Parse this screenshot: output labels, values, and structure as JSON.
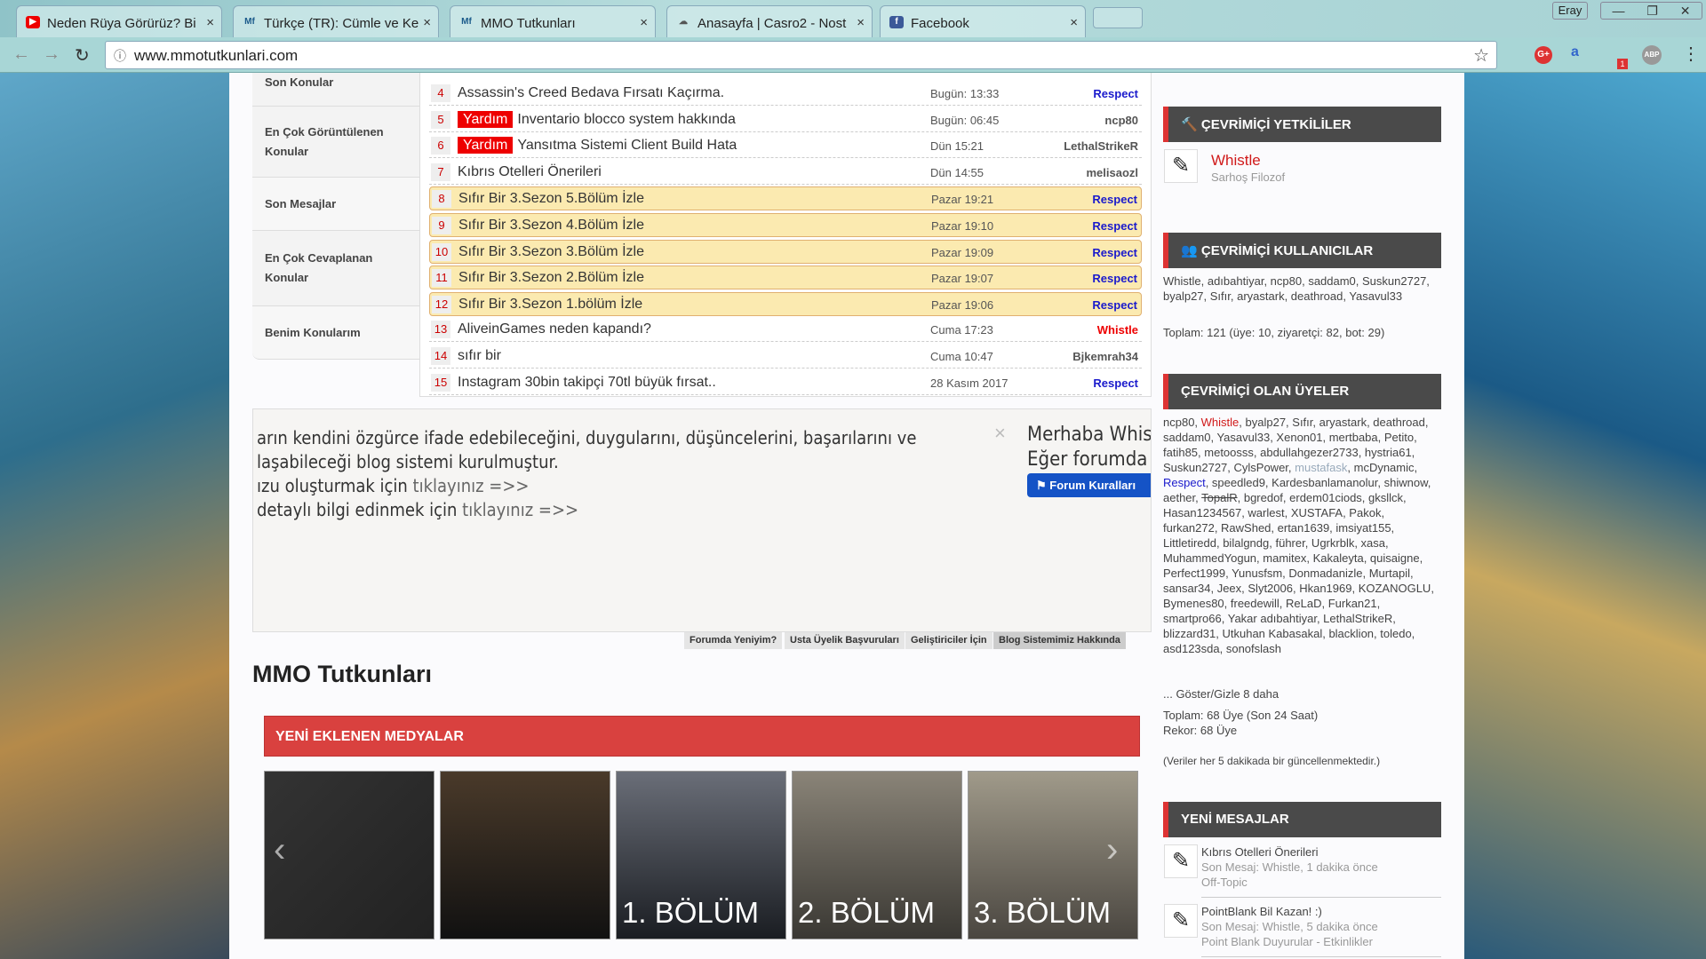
{
  "browser": {
    "tabs": [
      {
        "title": "Neden Rüya Görürüz? Bi",
        "icon": "youtube-icon"
      },
      {
        "title": "Türkçe (TR): Cümle ve Ke",
        "icon": "mmo-icon"
      },
      {
        "title": "MMO Tutkunları",
        "icon": "mmo-icon",
        "active": true
      },
      {
        "title": "Anasayfa | Casro2 - Nost",
        "icon": "casro-icon"
      },
      {
        "title": "Facebook",
        "icon": "facebook-icon"
      }
    ],
    "url": "www.mmotutkunlari.com",
    "profile": "Eray",
    "ext_badge": "1",
    "ext_abp": "ABP",
    "ext_gplus": "G+"
  },
  "nav": [
    "Son Konular",
    "En Çok Görüntülenen Konular",
    "Son Mesajlar",
    "En Çok Cevaplanan Konular",
    "Benim Konularım"
  ],
  "topics": [
    {
      "n": "4",
      "title": "Assassin's Creed Bedava Fırsatı Kaçırma.",
      "date": "Bugün: 13:33",
      "user": "Respect",
      "color": "#1a1acc"
    },
    {
      "n": "5",
      "badge": "Yardım",
      "title": "Inventario blocco system hakkında",
      "date": "Bugün: 06:45",
      "user": "ncp80",
      "color": "#555"
    },
    {
      "n": "6",
      "badge": "Yardım",
      "title": "Yansıtma Sistemi Client Build Hata",
      "date": "Dün 15:21",
      "user": "LethalStrikeR",
      "color": "#555"
    },
    {
      "n": "7",
      "title": "Kıbrıs Otelleri Önerileri",
      "date": "Dün 14:55",
      "user": "melisaozl",
      "color": "#555"
    },
    {
      "n": "8",
      "title": "Sıfır Bir 3.Sezon 5.Bölüm İzle",
      "date": "Pazar 19:21",
      "user": "Respect",
      "color": "#1a1acc",
      "hl": true
    },
    {
      "n": "9",
      "title": "Sıfır Bir 3.Sezon 4.Bölüm İzle",
      "date": "Pazar 19:10",
      "user": "Respect",
      "color": "#1a1acc",
      "hl": true
    },
    {
      "n": "10",
      "title": "Sıfır Bir 3.Sezon 3.Bölüm İzle",
      "date": "Pazar 19:09",
      "user": "Respect",
      "color": "#1a1acc",
      "hl": true
    },
    {
      "n": "11",
      "title": "Sıfır Bir 3.Sezon 2.Bölüm İzle",
      "date": "Pazar 19:07",
      "user": "Respect",
      "color": "#1a1acc",
      "hl": true
    },
    {
      "n": "12",
      "title": "Sıfır Bir 3.Sezon 1.bölüm İzle",
      "date": "Pazar 19:06",
      "user": "Respect",
      "color": "#1a1acc",
      "hl": true
    },
    {
      "n": "13",
      "title": "AliveinGames neden kapandı?",
      "date": "Cuma 17:23",
      "user": "Whistle",
      "color": "#e00"
    },
    {
      "n": "14",
      "title": "sıfır bir",
      "date": "Cuma 10:47",
      "user": "Bjkemrah34",
      "color": "#555"
    },
    {
      "n": "15",
      "title": "Instagram 30bin takipçi 70tl büyük fırsat..",
      "date": "28 Kasım 2017",
      "user": "Respect",
      "color": "#1a1acc"
    }
  ],
  "blog": {
    "line1": "arın kendini özgürce ifade edebileceğini, duygularını, düşüncelerini, başarılarını ve",
    "line2": "laşabileceği blog sistemi kurulmuştur.",
    "line3a": "ızu oluşturmak için ",
    "line3b": "tıklayınız =>>",
    "line4a": " detaylı bilgi edinmek için ",
    "line4b": "tıklayınız =>>",
    "right1": "Merhaba Whis",
    "right2": "Eğer forumda",
    "button": "Forum Kuralları"
  },
  "blog_tabs": [
    "Forumda Yeniyim?",
    "Usta Üyelik Başvuruları",
    "Geliştiriciler İçin",
    "Blog Sistemimiz Hakkında"
  ],
  "heading": "MMO Tutkunları",
  "media": {
    "title": "YENİ EKLENEN MEDYALAR",
    "items": [
      "",
      "",
      "1. BÖLÜM",
      "2. BÖLÜM",
      "3. BÖLÜM"
    ]
  },
  "sidebar": {
    "staff": {
      "title": "ÇEVRİMİÇİ YETKİLİLER",
      "name": "Whistle",
      "rank": "Sarhoş Filozof"
    },
    "online": {
      "title": "ÇEVRİMİÇİ KULLANICILAR",
      "users": "Whistle, adıbahtiyar, ncp80, saddam0, Suskun2727, byalp27, Sıfır, aryastark, deathroad, Yasavul33",
      "total": "Toplam: 121 (üye: 10, ziyaretçi: 82, bot: 29)"
    },
    "members": {
      "title": "ÇEVRİMİÇİ OLAN ÜYELER",
      "pre": "ncp80, ",
      "red": "Whistle",
      "mid": ", byalp27, Sıfır, aryastark, deathroad, saddam0, Yasavul33, Xenon01, mertbaba, Petito, fatih85, metoosss, abdullahgezer2733, hystria61, Suskun2727, CylsPower, ",
      "faded": "mustafask",
      "mid2": ", mcDynamic, ",
      "blue": "Respect",
      "mid3": ", speedled9, Kardesbanlamanolur, shiwnow, aether, ",
      "strike": "TopalR",
      "rest": ", bgredof, erdem01ciods, gksllck, Hasan1234567, warlest, XUSTAFA, Pakok, furkan272, RawShed, ertan1639, imsiyat155, Littletiredd, bilalgndg, führer, Ugrkrblk, xasa, MuhammedYogun, mamitex, Kakaleyta, quisaigne, Perfect1999, Yunusfsm, Donmadanizle, Murtapil, sansar34, Jeex, Slyt2006, Hkan1969, KOZANOGLU, Bymenes80, freedewill, ReLaD, Furkan21, smartpro66, Yakar adıbahtiyar, LethalStrikeR, blizzard31, Utkuhan Kabasakal, blacklion, toledo, asd123sda, sonofslash",
      "more": "... Göster/Gizle 8 daha",
      "total": "Toplam: 68 Üye (Son 24 Saat)",
      "record": "Rekor: 68 Üye",
      "note": "(Veriler her 5 dakikada bir güncellenmektedir.)"
    },
    "new_posts": {
      "title": "YENİ MESAJLAR",
      "items": [
        {
          "title": "Kıbrıs Otelleri Önerileri",
          "meta": "Son Mesaj: Whistle, 1 dakika önce",
          "forum": "Off-Topic"
        },
        {
          "title": "PointBlank Bil Kazan! :)",
          "meta": "Son Mesaj: Whistle, 5 dakika önce",
          "forum": "Point Blank Duyurular - Etkinlikler"
        }
      ]
    }
  }
}
